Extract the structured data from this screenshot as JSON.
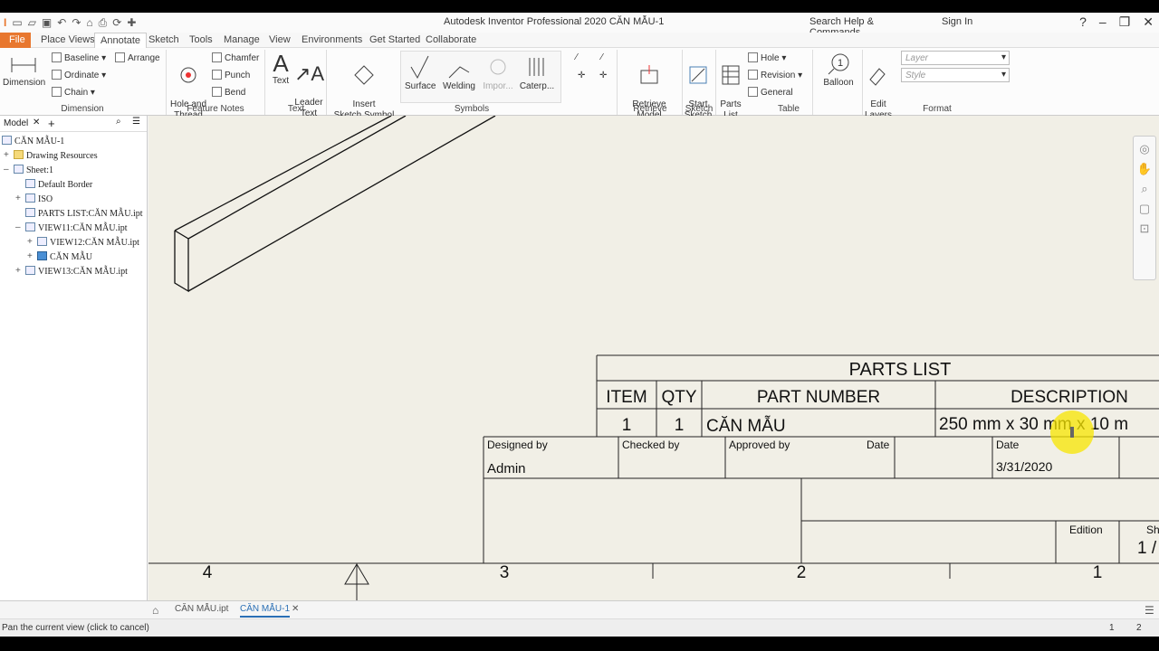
{
  "app": {
    "title": "Autodesk Inventor Professional 2020   CĂN MẪU-1",
    "search_placeholder": "Search Help & Commands...",
    "sign_in": "Sign In"
  },
  "tabs": [
    "File",
    "Place Views",
    "Annotate",
    "Sketch",
    "Tools",
    "Manage",
    "View",
    "Environments",
    "Get Started",
    "Collaborate"
  ],
  "active_tab": "Annotate",
  "ribbon": {
    "dimension": {
      "big": "Dimension",
      "baseline": "Baseline",
      "arrange": "Arrange",
      "ordinate": "Ordinate",
      "chain": "Chain",
      "panel": "Dimension"
    },
    "feature_notes": {
      "hole_thread": "Hole and\nThread",
      "chamfer": "Chamfer",
      "punch": "Punch",
      "bend": "Bend",
      "panel": "Feature Notes"
    },
    "text": {
      "text": "Text",
      "leader": "Leader\nText",
      "panel": "Text"
    },
    "symbols": {
      "insert": "Insert\nSketch Symbol",
      "surface": "Surface",
      "welding": "Welding",
      "import": "Impor...",
      "caterp": "Caterp...",
      "panel": "Symbols"
    },
    "retrieve": {
      "label": "Retrieve Model\nAnnotations",
      "panel": "Retrieve"
    },
    "sketch": {
      "label": "Start\nSketch",
      "panel": "Sketch"
    },
    "table": {
      "parts": "Parts\nList",
      "hole": "Hole",
      "revision": "Revision",
      "general": "General",
      "panel": "Table"
    },
    "balloon": "Balloon",
    "format": {
      "edit_layers": "Edit\nLayers",
      "layer": "Layer",
      "style": "Style",
      "panel": "Format"
    }
  },
  "browser": {
    "title": "Model",
    "items": [
      {
        "label": "CĂN MẪU-1"
      },
      {
        "label": "Drawing Resources"
      },
      {
        "label": "Sheet:1"
      },
      {
        "label": "Default Border"
      },
      {
        "label": "ISO"
      },
      {
        "label": "PARTS LIST:CĂN MẪU.ipt"
      },
      {
        "label": "VIEW11:CĂN MẪU.ipt"
      },
      {
        "label": "VIEW12:CĂN MẪU.ipt"
      },
      {
        "label": "CĂN MẪU"
      },
      {
        "label": "VIEW13:CĂN MẪU.ipt"
      }
    ]
  },
  "parts_list": {
    "title": "PARTS LIST",
    "headers": [
      "ITEM",
      "QTY",
      "PART NUMBER",
      "DESCRIPTION"
    ],
    "row": [
      "1",
      "1",
      "CĂN MẪU",
      "250 mm x 30 mm x 10 m"
    ]
  },
  "title_block": {
    "designed_by_label": "Designed by",
    "designed_by": "Admin",
    "checked_by_label": "Checked by",
    "approved_by_label": "Approved by",
    "date_label": "Date",
    "date2_label": "Date",
    "date_value": "3/31/2020",
    "edition_label": "Edition",
    "sheet_label": "Sh",
    "sheet_value": "1 /"
  },
  "border_zones": [
    "4",
    "3",
    "2",
    "1"
  ],
  "doc_tabs": [
    "CĂN MẪU.ipt",
    "CĂN MẪU-1"
  ],
  "status": {
    "text": "Pan the current view (click to cancel)",
    "n1": "1",
    "n2": "2"
  }
}
